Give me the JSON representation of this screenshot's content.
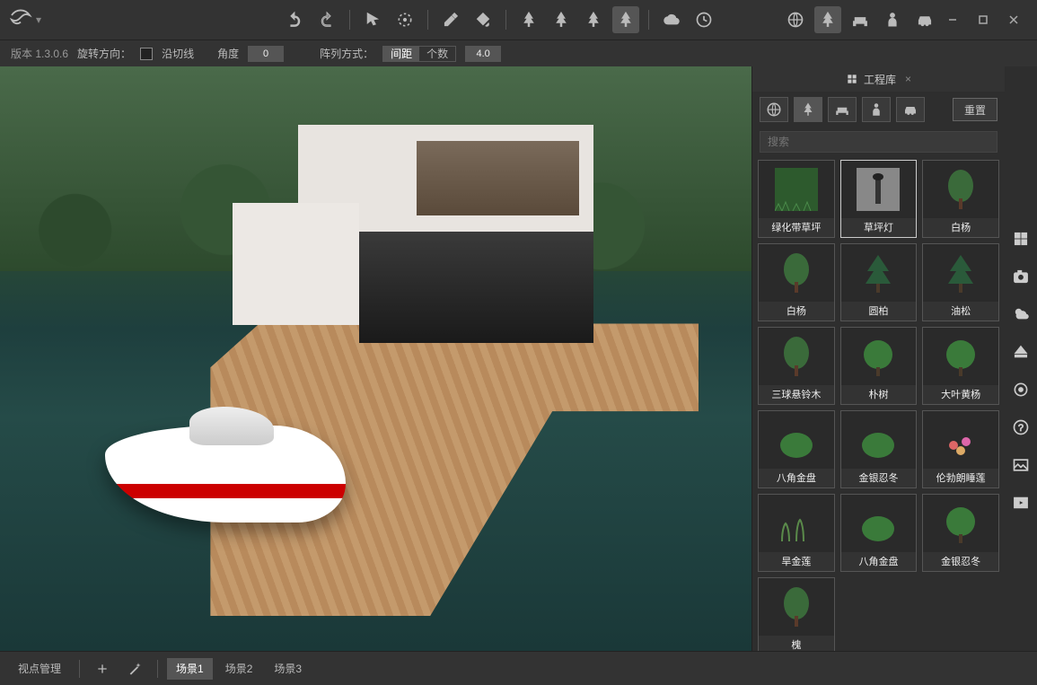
{
  "version_label": "版本 1.3.0.6",
  "sub": {
    "rotate_label": "旋转方向：",
    "tangent": "沿切线",
    "angle_label": "角度",
    "angle": "0",
    "array_label": "阵列方式：",
    "seg_distance": "间距",
    "seg_count": "个数",
    "array_value": "4.0"
  },
  "panel": {
    "title": "工程库",
    "reset": "重置",
    "search_placeholder": "搜索",
    "assets": [
      {
        "label": "绿化带草坪",
        "kind": "grass"
      },
      {
        "label": "草坪灯",
        "kind": "lamp",
        "selected": true
      },
      {
        "label": "白杨",
        "kind": "tree"
      },
      {
        "label": "白杨",
        "kind": "tree"
      },
      {
        "label": "圆柏",
        "kind": "conifer"
      },
      {
        "label": "油松",
        "kind": "conifer"
      },
      {
        "label": "三球悬铃木",
        "kind": "tree"
      },
      {
        "label": "朴树",
        "kind": "roundtree"
      },
      {
        "label": "大叶黄杨",
        "kind": "roundtree"
      },
      {
        "label": "八角金盘",
        "kind": "shrub"
      },
      {
        "label": "金银忍冬",
        "kind": "shrub"
      },
      {
        "label": "伦勃朗睡莲",
        "kind": "flower"
      },
      {
        "label": "旱金莲",
        "kind": "grass2"
      },
      {
        "label": "八角金盘",
        "kind": "shrub"
      },
      {
        "label": "金银忍冬",
        "kind": "roundtree"
      },
      {
        "label": "槐",
        "kind": "tree"
      }
    ]
  },
  "bottom": {
    "view_mgmt": "视点管理",
    "scenes": [
      "场景1",
      "场景2",
      "场景3"
    ],
    "selected_scene": 0
  }
}
